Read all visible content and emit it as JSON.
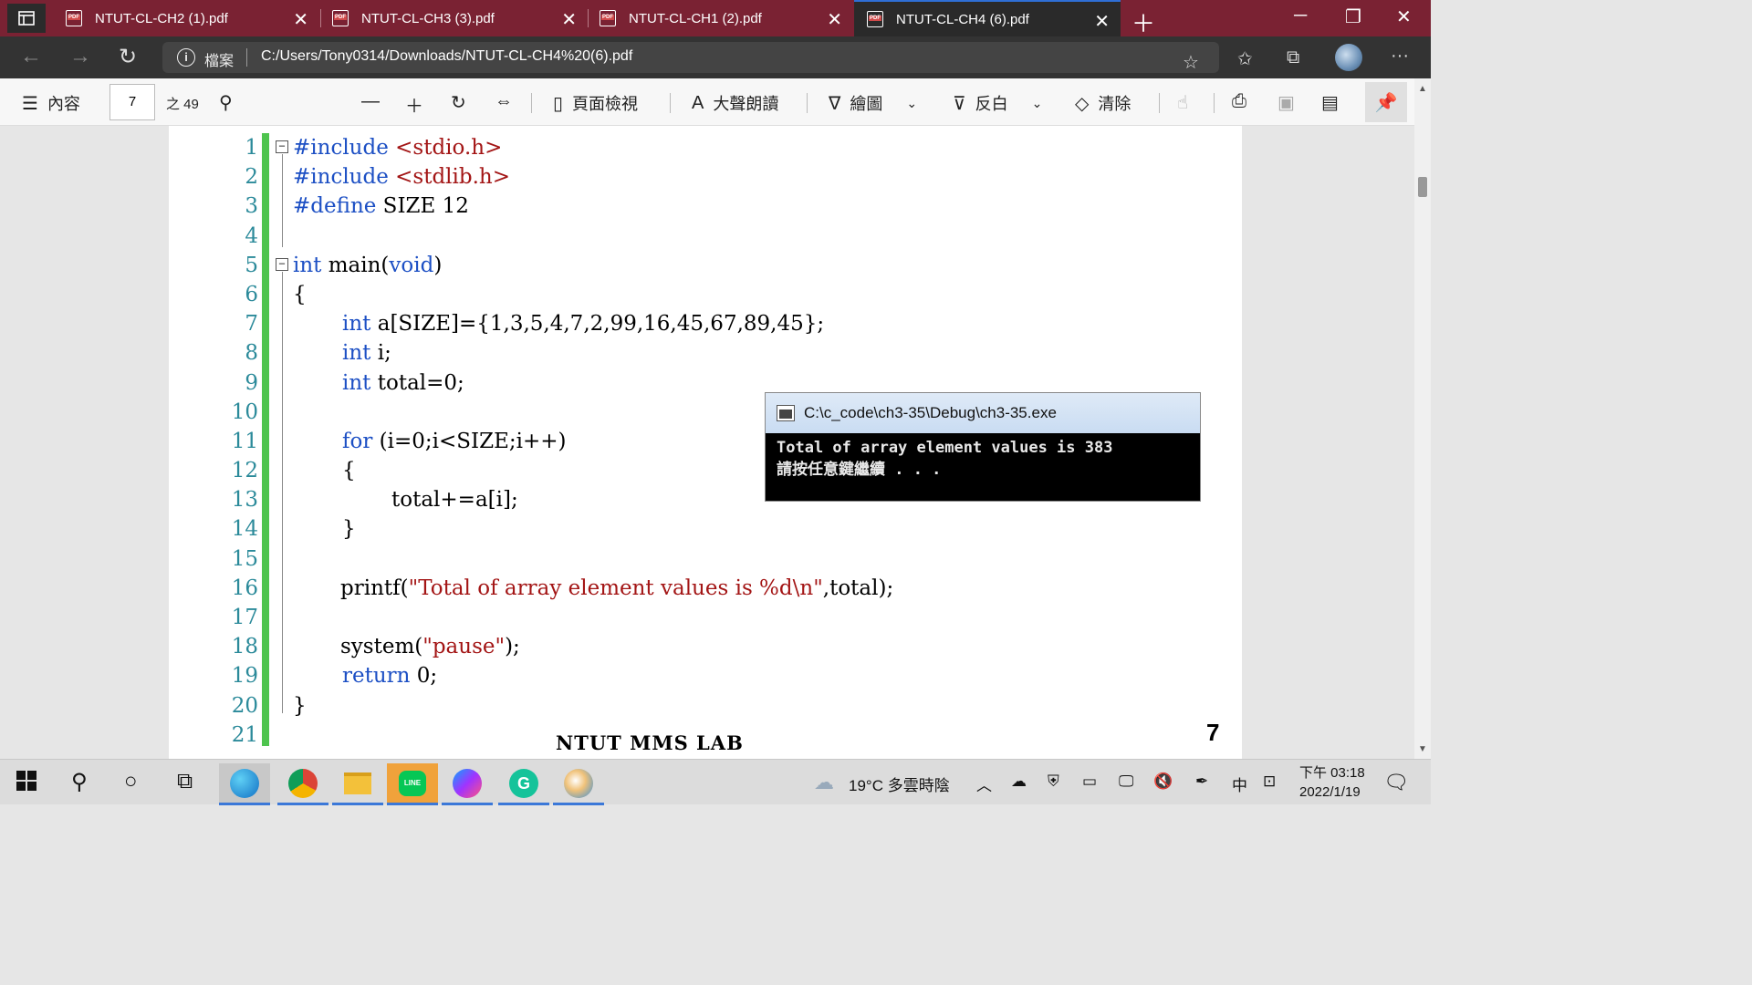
{
  "tabs": [
    {
      "title": "NTUT-CL-CH2 (1).pdf",
      "close": "✕"
    },
    {
      "title": "NTUT-CL-CH3 (3).pdf",
      "close": "✕"
    },
    {
      "title": "NTUT-CL-CH1 (2).pdf",
      "close": "✕"
    },
    {
      "title": "NTUT-CL-CH4 (6).pdf",
      "close": "✕"
    }
  ],
  "address": {
    "scheme_label": "檔案",
    "url": "C:/Users/Tony0314/Downloads/NTUT-CL-CH4%20(6).pdf"
  },
  "pdf_toolbar": {
    "contents_label": "內容",
    "page_current": "7",
    "page_total": "之 49",
    "page_view_label": "頁面檢視",
    "read_aloud_label": "大聲朗讀",
    "draw_label": "繪圖",
    "highlight_label": "反白",
    "erase_label": "清除"
  },
  "document": {
    "line_numbers": [
      "1",
      "2",
      "3",
      "4",
      "5",
      "6",
      "7",
      "8",
      "9",
      "10",
      "11",
      "12",
      "13",
      "14",
      "15",
      "16",
      "17",
      "18",
      "19",
      "20",
      "21"
    ],
    "code": {
      "l1_kw": "#include",
      "l1_rest": " <stdio.h>",
      "l2_kw": "#include",
      "l2_rest": " <stdlib.h>",
      "l3_kw": "#define",
      "l3_rest": " SIZE 12",
      "l5_kw": "int",
      "l5_mid": " main(",
      "l5_kw2": "void",
      "l5_end": ")",
      "l6": "{",
      "l7_kw": "int",
      "l7_rest": " a[SIZE]={1,3,5,4,7,2,99,16,45,67,89,45};",
      "l8_kw": "int",
      "l8_rest": " i;",
      "l9_kw": "int",
      "l9_rest": " total=0;",
      "l11_kw": "for",
      "l11_rest": " (i=0;i<SIZE;i++)",
      "l12": "{",
      "l13": "total+=a[i];",
      "l14": "}",
      "l16_pre": "printf(",
      "l16_str": "\"Total of array element values is %d\\n\"",
      "l16_post": ",total);",
      "l18_pre": "system(",
      "l18_str": "\"pause\"",
      "l18_post": ");",
      "l19_kw": "return",
      "l19_rest": " 0;",
      "l20": "}"
    },
    "footer_text": "NTUT MMS LAB",
    "page_number": "7"
  },
  "console": {
    "title": "C:\\c_code\\ch3-35\\Debug\\ch3-35.exe",
    "line1": "Total of array element values is 383",
    "line2": "請按任意鍵繼續 . . ."
  },
  "taskbar": {
    "weather": "19°C 多雲時陰",
    "ime": "中",
    "time": "下午 03:18",
    "date": "2022/1/19"
  }
}
